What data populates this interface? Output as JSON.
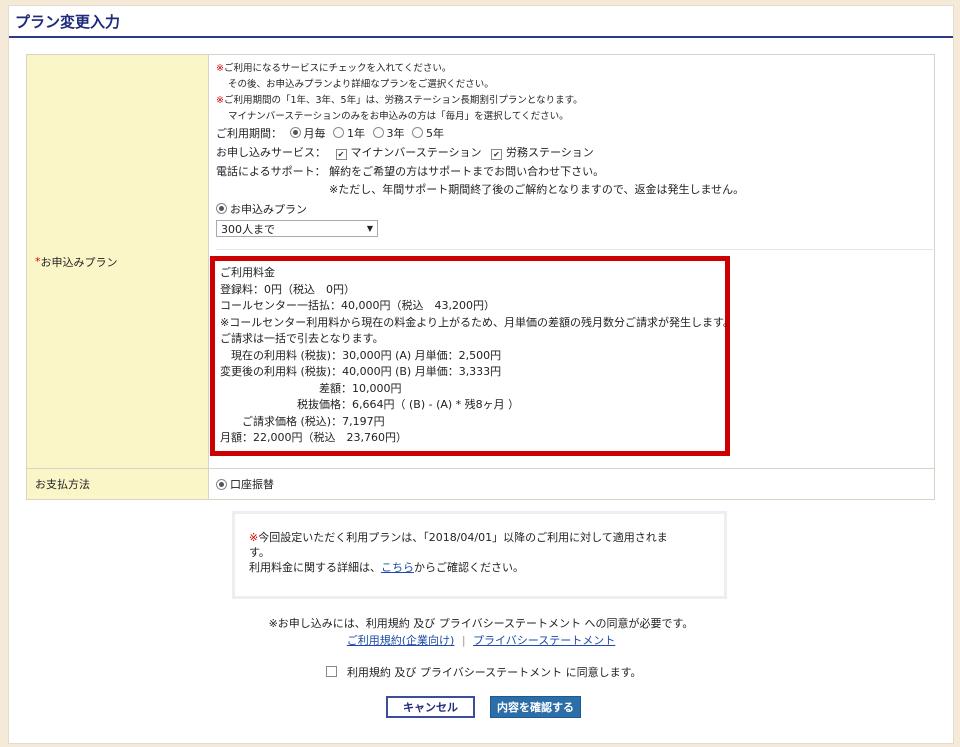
{
  "page": {
    "title": "プラン変更入力"
  },
  "plan_section": {
    "label_req": "*",
    "label": "お申込みプラン",
    "notes": [
      {
        "mark": "※",
        "text": "ご利用になるサービスにチェックを入れてください。"
      },
      {
        "mark": "",
        "text": "その後、お申込みプランより詳細なプランをご選択ください。"
      },
      {
        "mark": "※",
        "text": "ご利用期間の「1年、3年、5年」は、労務ステーション長期割引プランとなります。"
      },
      {
        "mark": "",
        "text": "マイナンバーステーションのみをお申込みの方は「毎月」を選択してください。"
      }
    ],
    "period_label": "ご利用期間：",
    "period_options": [
      "月毎",
      "1年",
      "3年",
      "5年"
    ],
    "service_label": "お申し込みサービス：",
    "services": [
      "マイナンバーステーション",
      "労務ステーション"
    ],
    "support_label": "電話によるサポート：",
    "support_text": "解約をご希望の方はサポートまでお問い合わせ下さい。",
    "support_note": "※ただし、年間サポート期間終了後のご解約となりますので、返金は発生しません。",
    "plan_radio_label": "お申込みプラン",
    "plan_select_value": "300人まで"
  },
  "fee": {
    "lines": [
      "ご利用料金",
      "登録料：0円（税込　0円）",
      "コールセンター一括払：40,000円（税込　43,200円）",
      "※コールセンター利用料から現在の料金より上がるため、月単価の差額の残月数分ご請求が発生します。",
      "ご請求は一括で引去となります。",
      "　現在の利用料 (税抜)：30,000円 (A) 月単価：2,500円",
      "変更後の利用料 (税抜)：40,000円 (B) 月単価：3,333円",
      "　　　　　　　　　差額：10,000円",
      "　　　　　　　税抜価格：6,664円（ (B) - (A) * 残8ヶ月 ）",
      "　　ご請求価格 (税込)：7,197円",
      "月額：22,000円（税込　23,760円）"
    ]
  },
  "payment": {
    "label": "お支払方法",
    "option": "口座振替"
  },
  "notice": {
    "mark": "※",
    "line1": "今回設定いただく利用プランは、「2018/04/01」以降のご利用に対して適用されま",
    "line2": "す。",
    "line3_pre": "利用料金に関する詳細は、",
    "line3_link": "こちら",
    "line3_post": "からご確認ください。"
  },
  "agreement": {
    "note": "※お申し込みには、利用規約 及び プライバシーステートメント への同意が必要です。",
    "terms_link": "ご利用規約(企業向け)",
    "separator": "|",
    "privacy_link": "プライバシーステートメント",
    "checkbox_label": "利用規約 及び プライバシーステートメント に同意します。"
  },
  "buttons": {
    "cancel": "キャンセル",
    "confirm": "内容を確認する"
  },
  "colors": {
    "title": "#1d2a7a",
    "label_bg": "#fbf6c8",
    "highlight_border": "#cc0000",
    "confirm_bg": "#2c6ea8"
  }
}
